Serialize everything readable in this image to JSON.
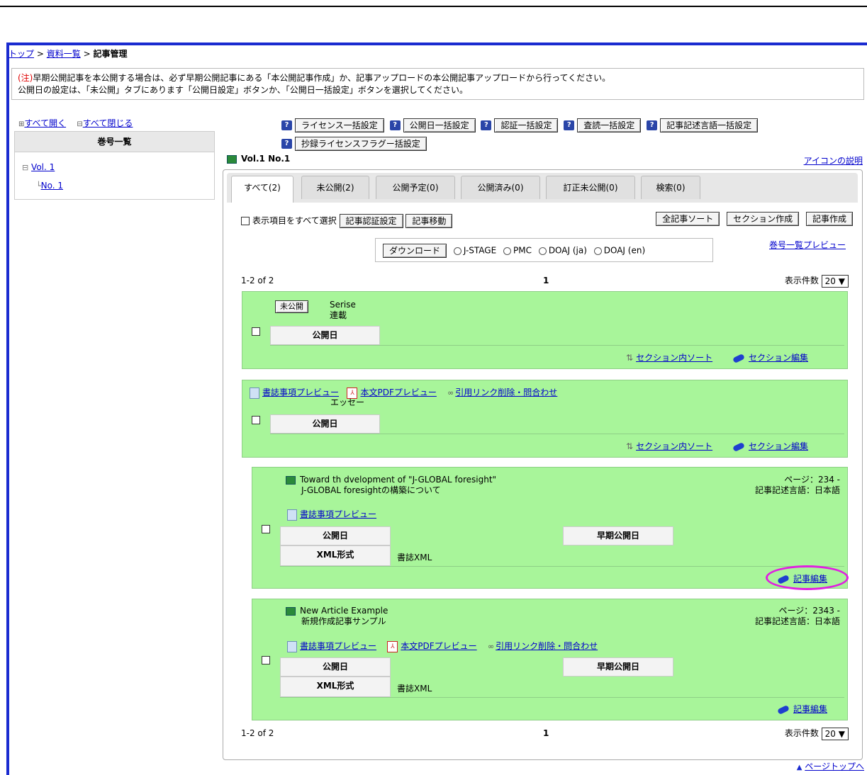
{
  "breadcrumb": {
    "top": "トップ",
    "sep1": ">",
    "list": "資料一覧",
    "sep2": ">",
    "current": "記事管理"
  },
  "notice": {
    "mark": "(注)",
    "line1": "早期公開記事を本公開する場合は、必ず早期公開記事にある「本公開記事作成」か、記事アップロードの本公開記事アップロードから行ってください。",
    "line2": "公開日の設定は、「未公開」タブにあります「公開日設定」ボタンか、「公開日一括設定」ボタンを選択してください。"
  },
  "tree": {
    "expand_all": "すべて開く",
    "collapse_all": "すべて閉じる",
    "heading": "巻号一覧",
    "vol": "Vol. 1",
    "no": "No. 1"
  },
  "toolbar": {
    "help": "?",
    "license_bulk": "ライセンス一括設定",
    "pubdate_bulk": "公開日一括設定",
    "auth_bulk": "認証一括設定",
    "review_bulk": "査読一括設定",
    "lang_bulk": "記事記述言語一括設定",
    "abstract_license_bulk": "抄録ライセンスフラグー括設定"
  },
  "volume_label": "Vol.1 No.1",
  "icon_desc": "アイコンの説明",
  "tabs": [
    {
      "label": "すべて(2)",
      "active": true
    },
    {
      "label": "未公開(2)"
    },
    {
      "label": "公開予定(0)"
    },
    {
      "label": "公開済み(0)"
    },
    {
      "label": "訂正未公開(0)"
    },
    {
      "label": "検索(0)"
    }
  ],
  "controls": {
    "select_all": "表示項目をすべて選択",
    "auth_setting": "記事認証設定",
    "move": "記事移動",
    "sort_all": "全記事ソート",
    "make_section": "セクション作成",
    "make_article": "記事作成",
    "download": "ダウンロード",
    "formats": [
      "J-STAGE",
      "PMC",
      "DOAJ (ja)",
      "DOAJ (en)"
    ],
    "list_preview": "巻号一覧プレビュー"
  },
  "pager": {
    "range": "1-2 of 2",
    "page": "1",
    "per_page_label": "表示件数",
    "per_page": "20"
  },
  "section1": {
    "status": "未公開",
    "title_en": "Serise",
    "title_ja": "連載",
    "pubdate_label": "公開日",
    "sort_link": "セクション内ソート",
    "edit_link": "セクション編集"
  },
  "section2": {
    "preview_biblio": "書誌事項プレビュー",
    "preview_pdf": "本文PDFプレビュー",
    "citation": "引用リンク削除・問合わせ",
    "title": "エッセー",
    "pubdate_label": "公開日",
    "sort_link": "セクション内ソート",
    "edit_link": "セクション編集"
  },
  "article1": {
    "title_en": "Toward th dvelopment of \"J-GLOBAL foresight\"",
    "title_ja": "J-GLOBAL foresightの構築について",
    "pages": "ページ：234 -",
    "lang": "記事記述言語：日本語",
    "preview_biblio": "書誌事項プレビュー",
    "pubdate_label": "公開日",
    "early_label": "早期公開日",
    "xml_label": "XML形式",
    "xml_value": "書誌XML",
    "edit": "記事編集"
  },
  "article2": {
    "title_en": "New Article Example",
    "title_ja": "新規作成記事サンプル",
    "pages": "ページ：2343 -",
    "lang": "記事記述言語：日本語",
    "preview_biblio": "書誌事項プレビュー",
    "preview_pdf": "本文PDFプレビュー",
    "citation": "引用リンク削除・問合わせ",
    "pubdate_label": "公開日",
    "early_label": "早期公開日",
    "xml_label": "XML形式",
    "xml_value": "書誌XML",
    "edit": "記事編集"
  },
  "page_top": "ページトップへ",
  "colors": {
    "frame": "#1a2bd0",
    "green": "#a8f59a",
    "link": "#0000cc",
    "highlight": "#e020e0"
  }
}
